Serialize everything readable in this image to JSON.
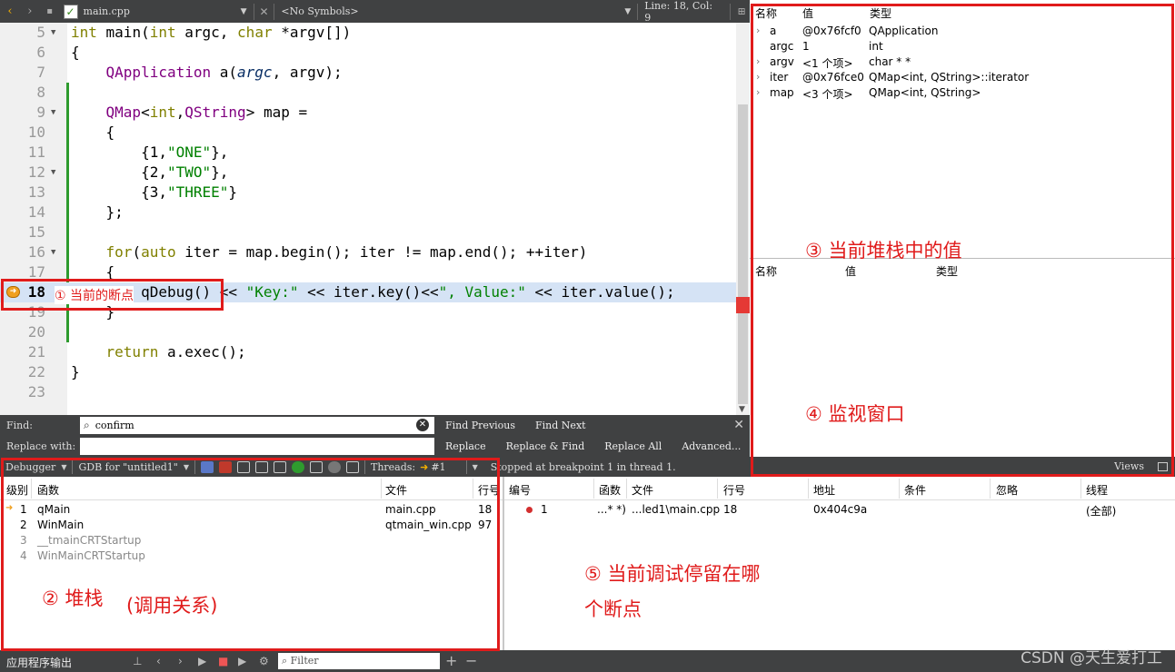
{
  "editor_toolbar": {
    "file_name": "main.cpp",
    "symbols": "<No Symbols>",
    "position": "Line: 18, Col: 9"
  },
  "code": [
    {
      "num": "5",
      "text": "int main(int argc, char *argv[])"
    },
    {
      "num": "6",
      "text": "{"
    },
    {
      "num": "7",
      "text": "    QApplication a(argc, argv);"
    },
    {
      "num": "8",
      "text": ""
    },
    {
      "num": "9",
      "text": "    QMap<int,QString> map ="
    },
    {
      "num": "10",
      "text": "    {"
    },
    {
      "num": "11",
      "text": "        {1,\"ONE\"},"
    },
    {
      "num": "12",
      "text": "        {2,\"TWO\"},"
    },
    {
      "num": "13",
      "text": "        {3,\"THREE\"}"
    },
    {
      "num": "14",
      "text": "    };"
    },
    {
      "num": "15",
      "text": ""
    },
    {
      "num": "16",
      "text": "    for(auto iter = map.begin(); iter != map.end(); ++iter)"
    },
    {
      "num": "17",
      "text": "    {"
    },
    {
      "num": "18",
      "text": "        qDebug() << \"Key:\" << iter.key()<<\", Value:\" << iter.value();"
    },
    {
      "num": "19",
      "text": "    }"
    },
    {
      "num": "20",
      "text": ""
    },
    {
      "num": "21",
      "text": "    return a.exec();"
    },
    {
      "num": "22",
      "text": "}"
    },
    {
      "num": "23",
      "text": ""
    }
  ],
  "find_bar": {
    "find_label": "Find:",
    "find_value": "confirm",
    "replace_label": "Replace with:",
    "find_previous": "Find Previous",
    "find_next": "Find Next",
    "replace": "Replace",
    "replace_find": "Replace & Find",
    "replace_all": "Replace All",
    "advanced": "Advanced..."
  },
  "locals": {
    "headers": [
      "名称",
      "值",
      "类型"
    ],
    "rows": [
      {
        "expandable": true,
        "name": "a",
        "value": "@0x76fcf0",
        "type": "QApplication"
      },
      {
        "expandable": false,
        "name": "argc",
        "value": "1",
        "type": "int"
      },
      {
        "expandable": true,
        "name": "argv",
        "value": "<1 个项>",
        "type": "char * *"
      },
      {
        "expandable": true,
        "name": "iter",
        "value": "@0x76fce0",
        "type": "QMap<int, QString>::iterator"
      },
      {
        "expandable": true,
        "name": "map",
        "value": "<3 个项>",
        "type": "QMap<int, QString>"
      }
    ]
  },
  "watch": {
    "headers": [
      "名称",
      "值",
      "类型"
    ]
  },
  "right_bar": {
    "views": "Views"
  },
  "debugger_bar": {
    "mode": "Debugger",
    "engine": "GDB for \"untitled1\"",
    "threads_label": "Threads:",
    "thread_value": "#1",
    "status": "Stopped at breakpoint 1 in thread 1."
  },
  "stack": {
    "headers": [
      "级别",
      "函数",
      "文件",
      "行号"
    ],
    "rows": [
      {
        "level": "1",
        "func": "qMain",
        "file": "main.cpp",
        "line": "18",
        "current": true
      },
      {
        "level": "2",
        "func": "WinMain",
        "file": "qtmain_win.cpp",
        "line": "97",
        "current": false
      },
      {
        "level": "3",
        "func": "__tmainCRTStartup",
        "file": "",
        "line": "",
        "current": false
      },
      {
        "level": "4",
        "func": "WinMainCRTStartup",
        "file": "",
        "line": "",
        "current": false
      }
    ]
  },
  "breakpoints": {
    "headers": [
      "编号",
      "函数",
      "文件",
      "行号",
      "地址",
      "条件",
      "忽略",
      "线程"
    ],
    "rows": [
      {
        "num": "1",
        "func": "...* *)",
        "file": "...led1\\main.cpp",
        "line": "18",
        "address": "0x404c9a",
        "cond": "",
        "ignore": "",
        "thread": "(全部)"
      }
    ]
  },
  "output_bar": {
    "label": "应用程序输出",
    "filter_placeholder": "Filter"
  },
  "annotations": {
    "a1": "① 当前的断点",
    "a2": "② 堆栈",
    "a2b": "(调用关系)",
    "a3": "③ 当前堆栈中的值",
    "a4": "④ 监视窗口",
    "a5_line1": "⑤ 当前调试停留在哪",
    "a5_line2": "个断点"
  },
  "watermark": "CSDN @天生爱打工",
  "colors": {
    "annotation_red": "#e01b1b",
    "keyword": "#808000",
    "type": "#800080",
    "string": "#008000",
    "toolbar_dark": "#404142"
  }
}
